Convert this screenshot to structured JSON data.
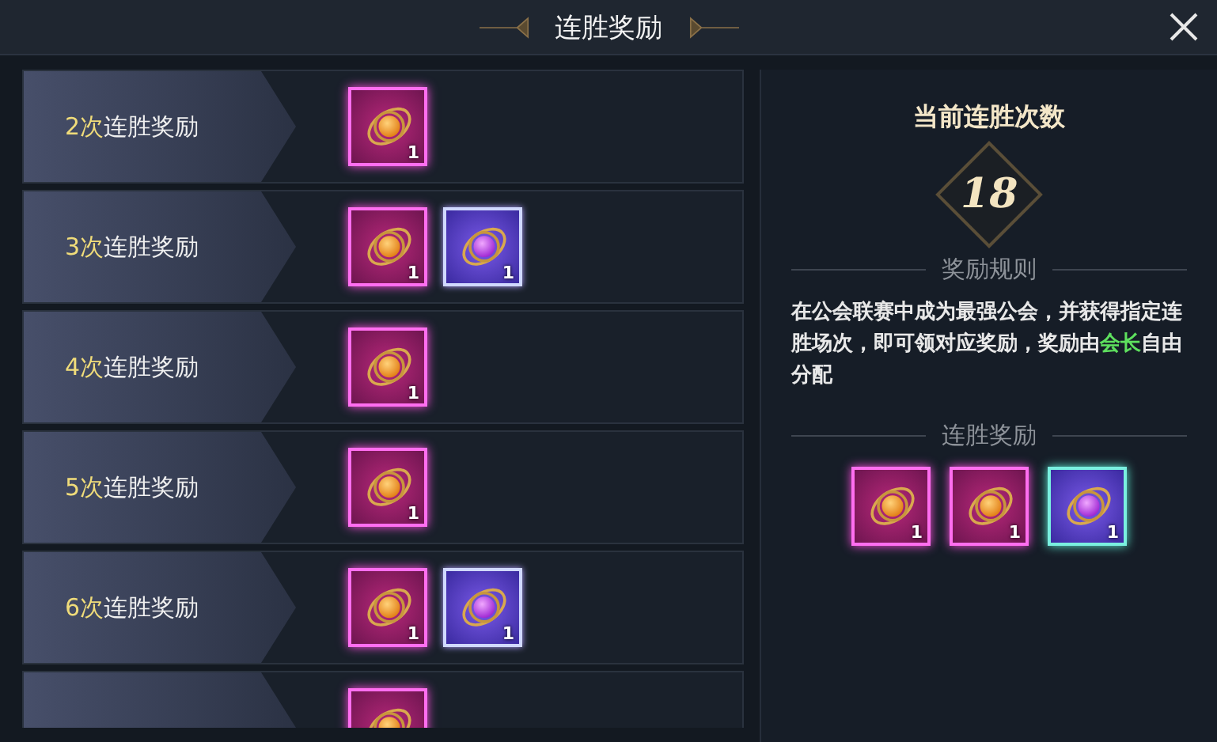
{
  "window": {
    "title": "连胜奖励"
  },
  "tiers": [
    {
      "count": "2次",
      "label": "连胜奖励",
      "items": [
        {
          "kind": "orange",
          "qty": "1"
        }
      ]
    },
    {
      "count": "3次",
      "label": "连胜奖励",
      "items": [
        {
          "kind": "orange",
          "qty": "1"
        },
        {
          "kind": "purple",
          "qty": "1"
        }
      ]
    },
    {
      "count": "4次",
      "label": "连胜奖励",
      "items": [
        {
          "kind": "orange",
          "qty": "1"
        }
      ]
    },
    {
      "count": "5次",
      "label": "连胜奖励",
      "items": [
        {
          "kind": "orange",
          "qty": "1"
        }
      ]
    },
    {
      "count": "6次",
      "label": "连胜奖励",
      "items": [
        {
          "kind": "orange",
          "qty": "1"
        },
        {
          "kind": "purple",
          "qty": "1"
        }
      ]
    },
    {
      "items": [
        {
          "kind": "orange"
        }
      ]
    }
  ],
  "current": {
    "title": "当前连胜次数",
    "value": "18"
  },
  "rules": {
    "heading": "奖励规则",
    "before": "在公会联赛中成为最强公会，并获得指定连胜场次，即可领对应奖励，奖励由",
    "highlight": "会长",
    "after": "自由分配"
  },
  "streak_rewards": {
    "heading": "连胜奖励",
    "items": [
      {
        "kind": "orange",
        "qty": "1"
      },
      {
        "kind": "orange",
        "qty": "1"
      },
      {
        "kind": "purple_teal",
        "qty": "1"
      }
    ]
  }
}
